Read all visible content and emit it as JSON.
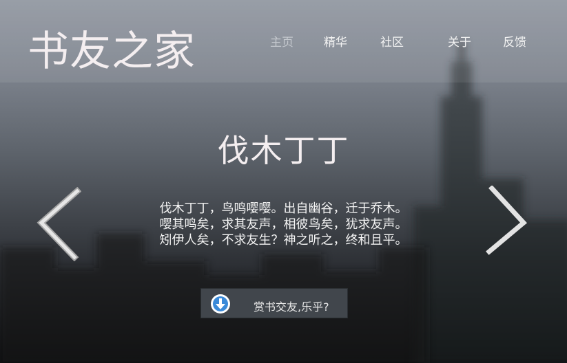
{
  "site": {
    "logo": "书友之家"
  },
  "nav": {
    "items": [
      {
        "label": "主页",
        "active": true
      },
      {
        "label": "精华",
        "active": false
      },
      {
        "label": "社区",
        "active": false
      },
      {
        "label": "关于",
        "active": false
      },
      {
        "label": "反馈",
        "active": false
      }
    ]
  },
  "hero": {
    "title": "伐木丁丁",
    "lines": [
      "伐木丁丁，鸟鸣嘤嘤。出自幽谷，迁于乔木。",
      "嘤其鸣矣，求其友声，相彼鸟矣，犹求友声。",
      "矧伊人矣，不求友生？神之听之，终和且平。"
    ]
  },
  "carousel": {
    "prev_icon": "chevron-left-icon",
    "next_icon": "chevron-right-icon"
  },
  "cta": {
    "label": "赏书交友,乐乎?",
    "icon": "download-icon"
  },
  "colors": {
    "header_overlay": "#a9aeb5",
    "cta_bg": "#41464c",
    "cta_icon": "#3b8ad8",
    "text": "#f4eef0"
  }
}
